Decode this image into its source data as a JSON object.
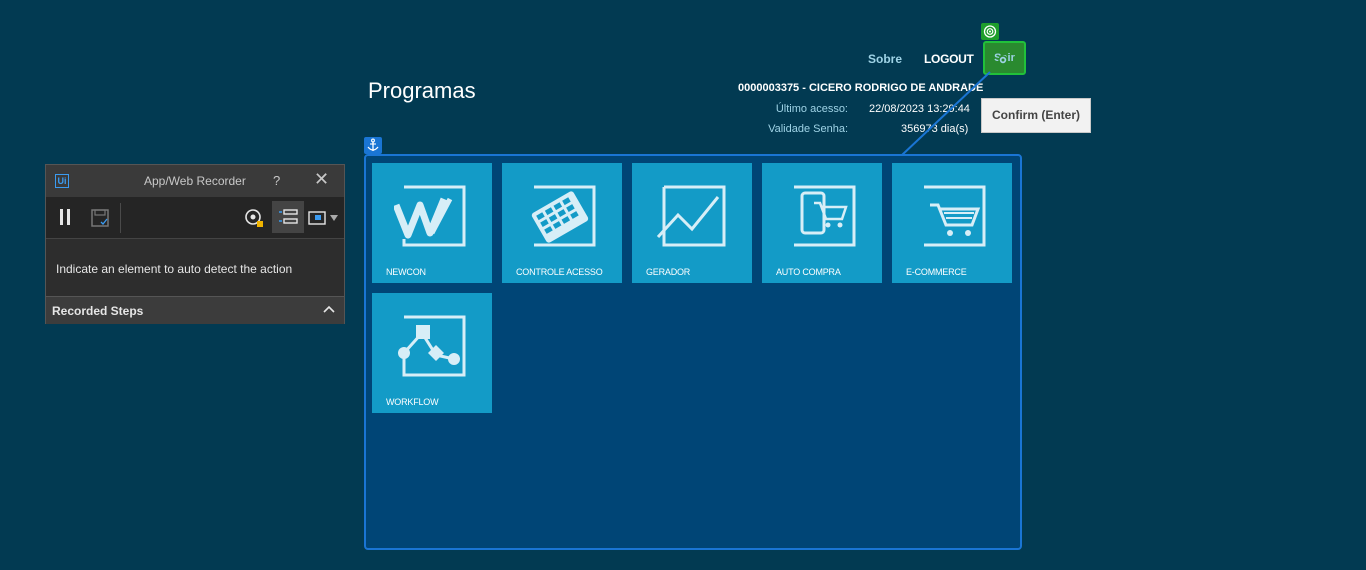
{
  "header": {
    "title": "Programas",
    "about_link": "Sobre",
    "logout_link": "LOGOUT",
    "exit_button": "Sair",
    "user_name": "0000003375 - CICERO RODRIGO DE ANDRADE",
    "last_access_label": "Último acesso:",
    "last_access_value": "22/08/2023 13:29:44",
    "password_validity_label": "Validade Senha:",
    "password_validity_value": "356973 dia(s)"
  },
  "tooltip": {
    "text": "Confirm (Enter)"
  },
  "programs": [
    {
      "label": "NEWCON",
      "icon": "newcon-icon"
    },
    {
      "label": "CONTROLE ACESSO",
      "icon": "keypad-icon"
    },
    {
      "label": "GERADOR",
      "icon": "chart-line-icon"
    },
    {
      "label": "AUTO COMPRA",
      "icon": "mobile-cart-icon"
    },
    {
      "label": "E-COMMERCE",
      "icon": "shopping-cart-icon"
    },
    {
      "label": "WORKFLOW",
      "icon": "workflow-icon"
    }
  ],
  "recorder": {
    "logo": "Ui",
    "title": "App/Web Recorder",
    "help": "?",
    "message": "Indicate an element to auto detect the action",
    "steps_label": "Recorded Steps"
  },
  "colors": {
    "background": "#023a52",
    "panel": "#004576",
    "panel_border": "#1a75d4",
    "tile": "#139bc7",
    "exit_highlight": "#2a8a2f"
  }
}
